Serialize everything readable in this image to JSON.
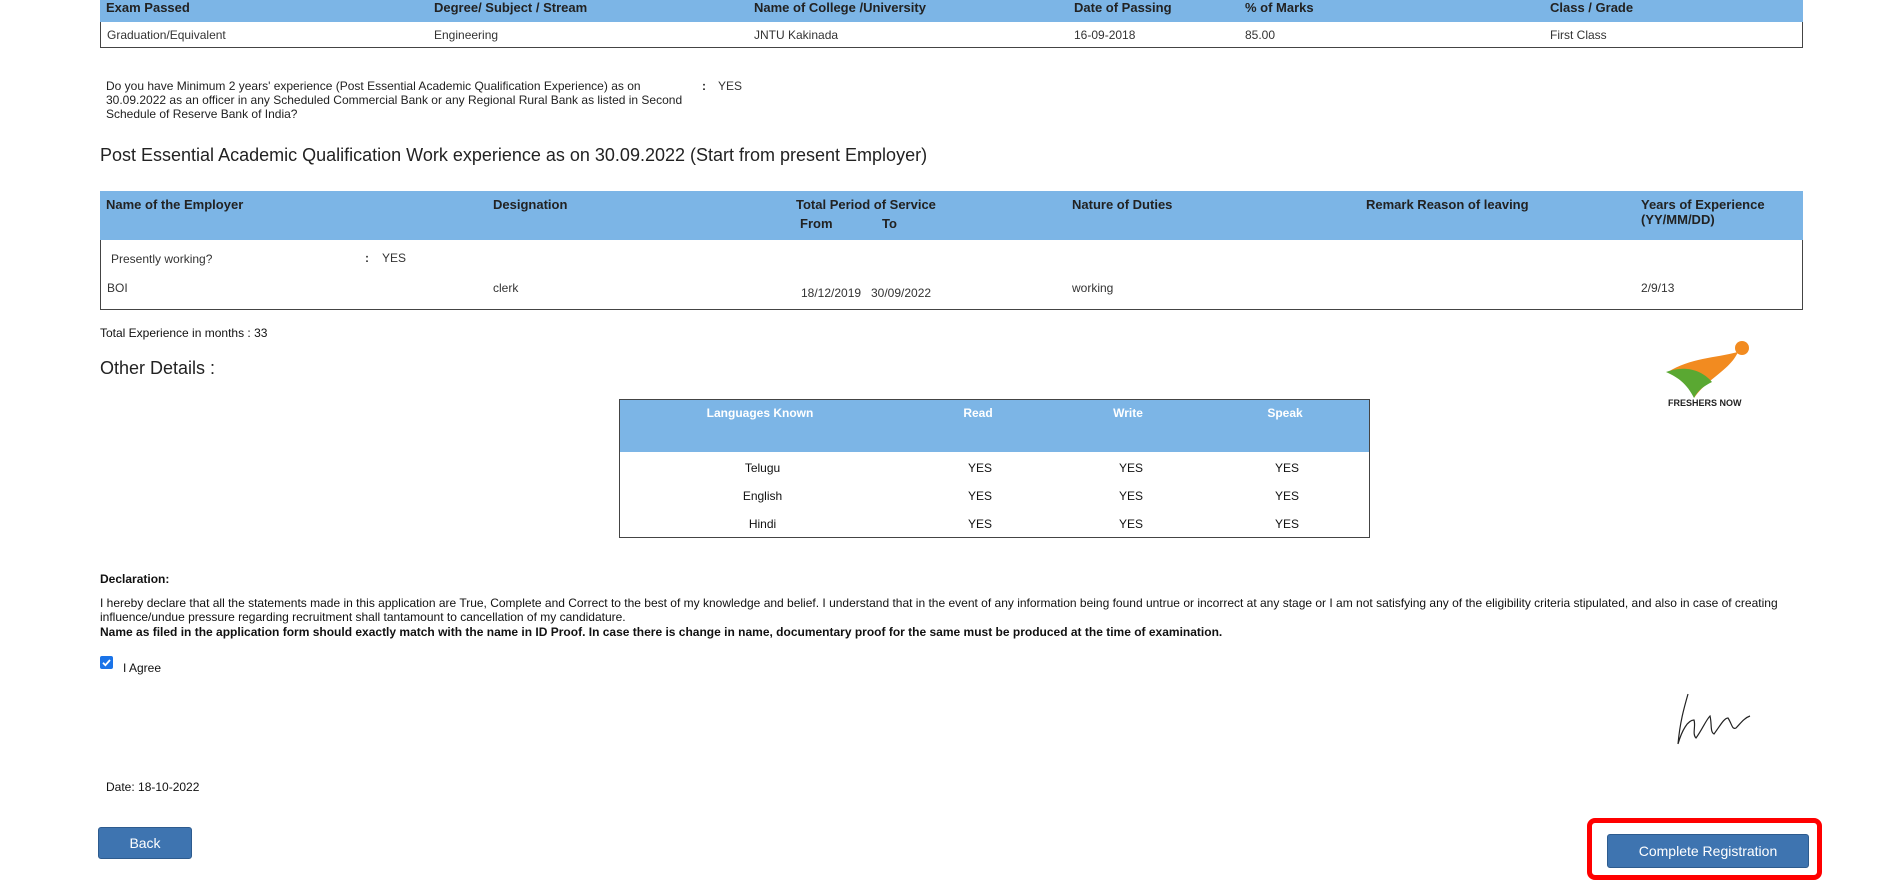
{
  "education": {
    "headers": [
      "Exam Passed",
      "Degree/ Subject / Stream",
      "Name of College /University",
      "Date of Passing",
      "% of Marks",
      "Class / Grade"
    ],
    "row": [
      "Graduation/Equivalent",
      "Engineering",
      "JNTU Kakinada",
      "16-09-2018",
      "85.00",
      "First Class"
    ]
  },
  "experience_question": {
    "text": "Do you have Minimum 2 years' experience (Post Essential Academic Qualification Experience) as on 30.09.2022 as an officer in any Scheduled Commercial Bank or any Regional Rural Bank as listed in Second Schedule of Reserve Bank of India?",
    "colon": ":",
    "answer": "YES"
  },
  "work_section": {
    "title": "Post Essential Academic Qualification Work experience as on 30.09.2022 (Start from present Employer)",
    "headers": {
      "employer": "Name of the Employer",
      "designation": "Designation",
      "period": "Total Period of Service",
      "from": "From",
      "to": "To",
      "duties": "Nature of Duties",
      "remark": "Remark Reason of leaving",
      "years": "Years of Experience",
      "years_format": "(YY/MM/DD)"
    },
    "presently_label": "Presently working?",
    "presently_colon": ":",
    "presently_value": "YES",
    "row": {
      "employer": "BOI",
      "designation": "clerk",
      "from": "18/12/2019",
      "to": "30/09/2022",
      "duties": "working",
      "years": "2/9/13"
    },
    "total": "Total Experience in months : 33"
  },
  "other_details": {
    "title": "Other Details :",
    "logo_text": "FRESHERS NOW",
    "lang_headers": [
      "Languages Known",
      "Read",
      "Write",
      "Speak"
    ],
    "languages": [
      {
        "name": "Telugu",
        "read": "YES",
        "write": "YES",
        "speak": "YES"
      },
      {
        "name": "English",
        "read": "YES",
        "write": "YES",
        "speak": "YES"
      },
      {
        "name": "Hindi",
        "read": "YES",
        "write": "YES",
        "speak": "YES"
      }
    ]
  },
  "declaration": {
    "title": "Declaration:",
    "text": "I hereby declare that all the statements made in this application are True, Complete and Correct to the best of my knowledge and belief. I understand that in the event of any information being found untrue or incorrect at any stage or I am not satisfying any of the eligibility criteria stipulated, and also in case of creating influence/undue pressure regarding recruitment shall tantamount to cancellation of my candidature.",
    "bold_text": "Name as filed in the application form should exactly match with the name in ID Proof. In case there is change in name, documentary proof for the same must be produced at the time of examination.",
    "agree_label": "I Agree",
    "date": "Date: 18-10-2022"
  },
  "buttons": {
    "back": "Back",
    "complete": "Complete Registration"
  },
  "colors": {
    "header_bg": "#7cb5e6",
    "button_bg": "#3e74b0",
    "highlight": "#ff0000"
  }
}
